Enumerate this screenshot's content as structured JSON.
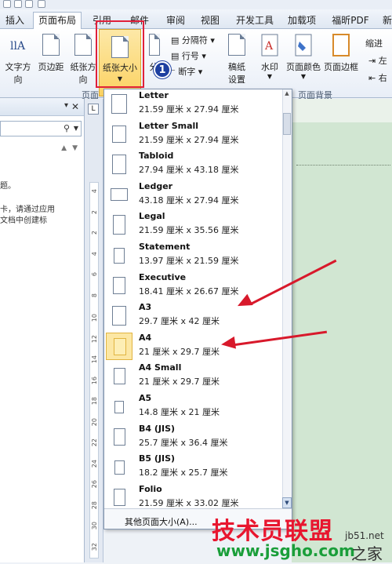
{
  "tabs": [
    "插入",
    "页面布局",
    "引用",
    "邮件",
    "审阅",
    "视图",
    "开发工具",
    "加载项",
    "福昕PDF",
    "新"
  ],
  "active_tab": "页面布局",
  "ribbon": {
    "text_direction": "文字方向",
    "margins": "页边距",
    "orientation": "纸张方向",
    "paper_size": "纸张大小",
    "columns": "分",
    "breaks": "分隔符",
    "line_numbers": "行号",
    "hyphenation": "断字",
    "manuscript": "稿纸",
    "manuscript2": "设置",
    "watermark": "水印",
    "page_color": "页面颜色",
    "page_border": "页面边框",
    "page_background_group": "页面背景",
    "page_group_partial": "页面",
    "indent": "缩进",
    "indent_left": "左",
    "indent_right": "右",
    "step_badge": "1"
  },
  "navpane": {
    "lines": [
      "题。",
      "卡，请通过应用",
      "文档中创建标"
    ]
  },
  "ruler_numbers": [
    "4",
    "2",
    "2",
    "4",
    "6",
    "8",
    "10",
    "12",
    "14",
    "16",
    "18",
    "20",
    "22",
    "24",
    "26",
    "28",
    "30",
    "32"
  ],
  "paper_sizes": [
    {
      "name": "Letter",
      "dims": "21.59 厘米 x 27.94 厘米"
    },
    {
      "name": "Letter Small",
      "dims": "21.59 厘米 x 27.94 厘米"
    },
    {
      "name": "Tabloid",
      "dims": "27.94 厘米 x 43.18 厘米"
    },
    {
      "name": "Ledger",
      "dims": "43.18 厘米 x 27.94 厘米"
    },
    {
      "name": "Legal",
      "dims": "21.59 厘米 x 35.56 厘米"
    },
    {
      "name": "Statement",
      "dims": "13.97 厘米 x 21.59 厘米"
    },
    {
      "name": "Executive",
      "dims": "18.41 厘米 x 26.67 厘米"
    },
    {
      "name": "A3",
      "dims": "29.7 厘米 x 42 厘米"
    },
    {
      "name": "A4",
      "dims": "21 厘米 x 29.7 厘米"
    },
    {
      "name": "A4 Small",
      "dims": "21 厘米 x 29.7 厘米"
    },
    {
      "name": "A5",
      "dims": "14.8 厘米 x 21 厘米"
    },
    {
      "name": "B4 (JIS)",
      "dims": "25.7 厘米 x 36.4 厘米"
    },
    {
      "name": "B5 (JIS)",
      "dims": "18.2 厘米 x 25.7 厘米"
    },
    {
      "name": "Folio",
      "dims": "21.59 厘米 x 33.02 厘米"
    }
  ],
  "selected_paper": "A4",
  "more_sizes": "其他页面大小(A)...",
  "watermark": {
    "brand": "技术员联盟",
    "url": "www.jsgho.com",
    "url2": "jb51.net",
    "suffix": "之家"
  },
  "colors": {
    "highlight": "#e0203a",
    "arrow": "#d8192b",
    "doc_bg": "#d1e6d2",
    "badge": "#1d3fa0"
  }
}
